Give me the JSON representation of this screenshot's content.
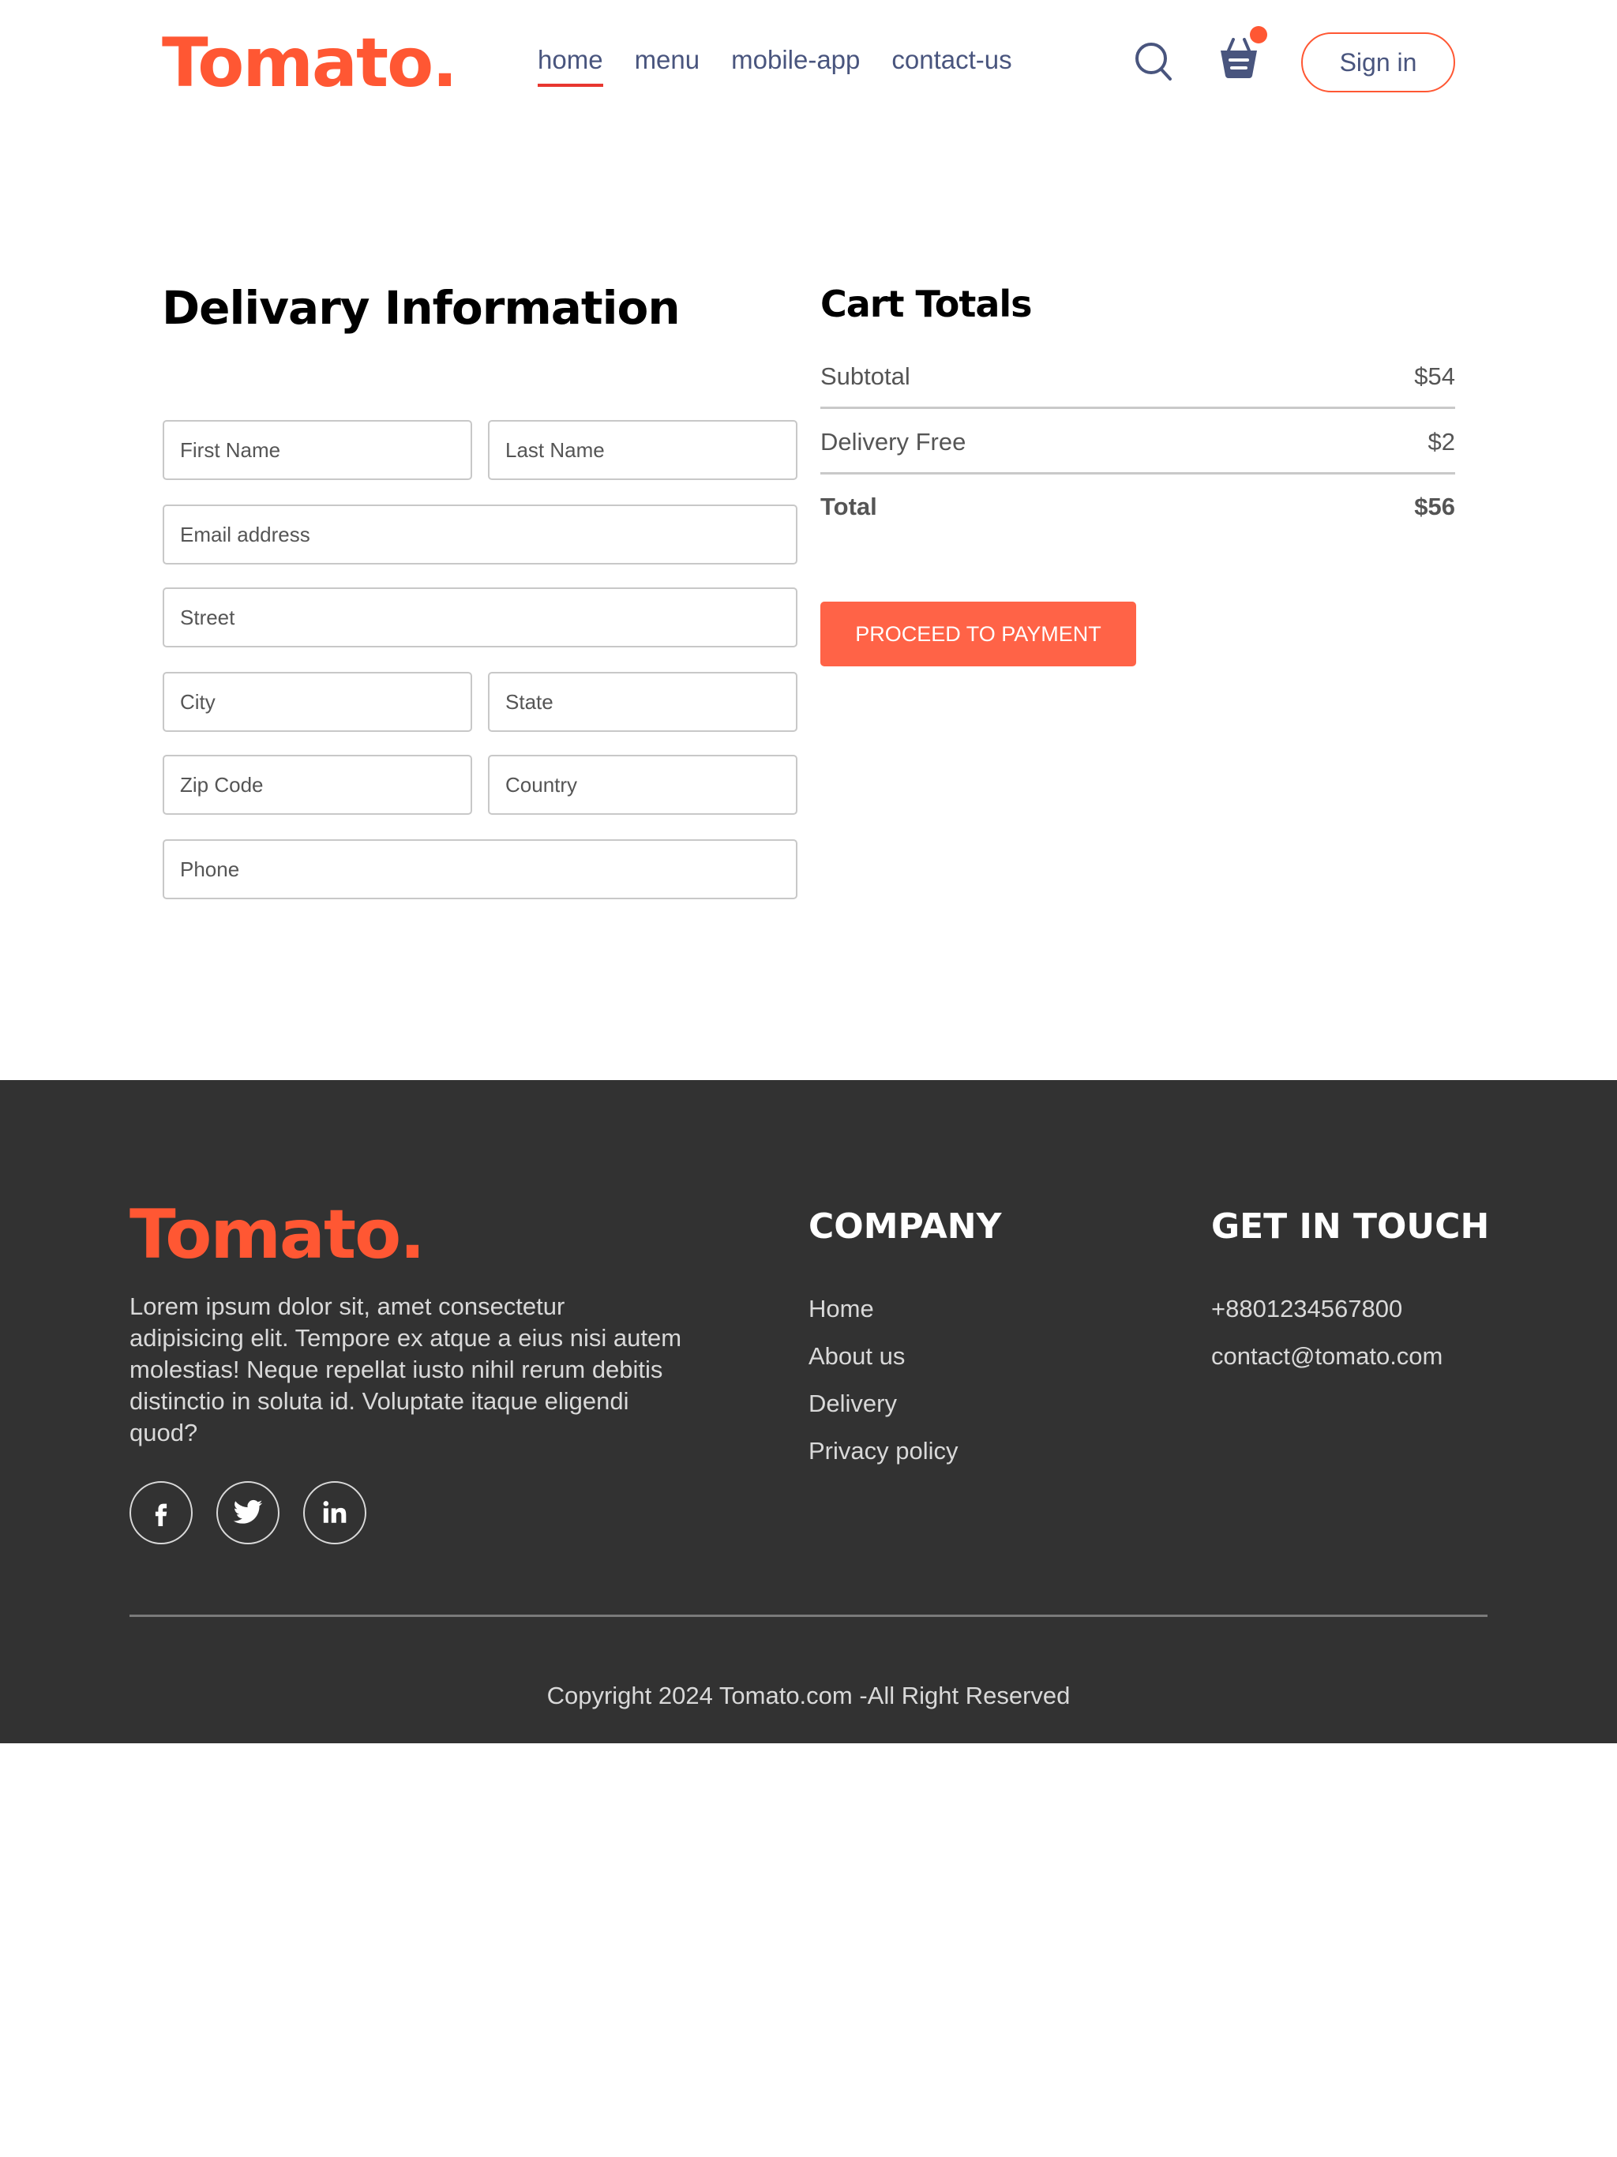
{
  "brand": {
    "logo": "Tomato.",
    "accent": "#ff5733",
    "dark": "#323232",
    "text": "#49557e"
  },
  "navbar": {
    "links": [
      "home",
      "menu",
      "mobile-app",
      "contact-us"
    ],
    "active": "home",
    "search_icon": "search-icon",
    "cart_icon": "basket-icon",
    "sign_in": "Sign in"
  },
  "delivery": {
    "title": "Delivary Information",
    "fields": {
      "first_name": "First Name",
      "last_name": "Last Name",
      "email": "Email address",
      "street": "Street",
      "city": "City",
      "state": "State",
      "zip": "Zip Code",
      "country": "Country",
      "phone": "Phone"
    }
  },
  "cart": {
    "title": "Cart Totals",
    "subtotal_label": "Subtotal",
    "subtotal_value": "$54",
    "delivery_label": "Delivery Free",
    "delivery_value": "$2",
    "total_label": "Total",
    "total_value": "$56",
    "proceed": "PROCEED TO PAYMENT"
  },
  "footer": {
    "logo": "Tomato.",
    "description": "Lorem ipsum dolor sit, amet consectetur adipisicing elit. Tempore ex atque a eius nisi autem molestias! Neque repellat iusto nihil rerum debitis distinctio in soluta id. Voluptate itaque eligendi quod?",
    "social_icons": [
      "facebook-icon",
      "twitter-icon",
      "linkedin-icon"
    ],
    "company_heading": "COMPANY",
    "company_links": [
      "Home",
      "About us",
      "Delivery",
      "Privacy policy"
    ],
    "contact_heading": "GET IN TOUCH",
    "contact_items": [
      "+8801234567800",
      "contact@tomato.com"
    ],
    "copyright": "Copyright 2024 Tomato.com -All Right Reserved"
  }
}
